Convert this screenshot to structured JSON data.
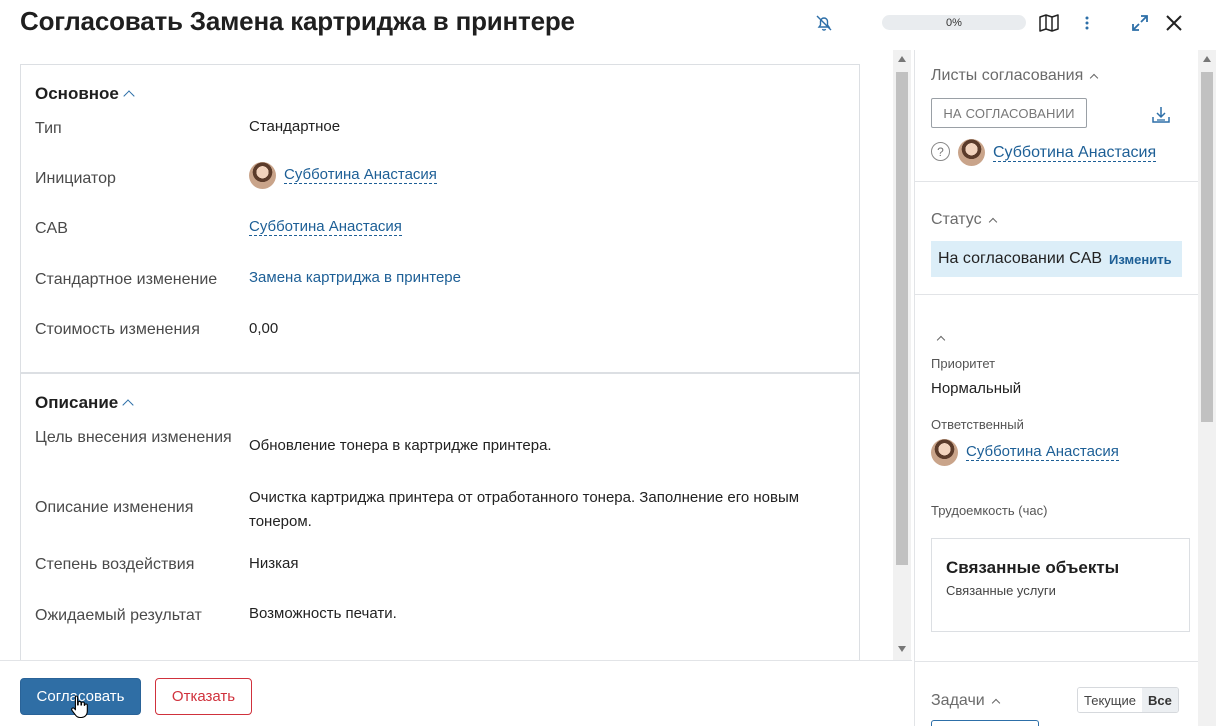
{
  "header": {
    "title": "Согласовать Замена картриджа в принтере",
    "progress": "0%",
    "icons": [
      "bell-off-icon",
      "map-icon",
      "more-vertical-icon",
      "expand-icon",
      "close-icon"
    ]
  },
  "main": {
    "section_main": {
      "title": "Основное",
      "rows": [
        {
          "label": "Тип",
          "value": "Стандартное"
        },
        {
          "label": "Инициатор",
          "value": "Субботина Анастасия"
        },
        {
          "label": "CAB",
          "value": "Субботина Анастасия"
        },
        {
          "label": "Стандартное изменение",
          "value": "Замена картриджа в принтере"
        },
        {
          "label": "Стоимость изменения",
          "value": "0,00"
        }
      ]
    },
    "section_desc": {
      "title": "Описание",
      "rows": [
        {
          "label": "Цель внесения изменения",
          "value": "Обновление тонера в картридже принтера."
        },
        {
          "label": "Описание изменения",
          "value": "Очистка картриджа принтера от отработанного тонера. Заполнение его новым тонером."
        },
        {
          "label": "Степень воздействия",
          "value": "Низкая"
        },
        {
          "label": "Ожидаемый результат",
          "value": "Возможность печати."
        }
      ]
    }
  },
  "footer": {
    "approve_label": "Согласовать",
    "reject_label": "Отказать"
  },
  "sidebar": {
    "approval_sheets": {
      "title": "Листы согласования",
      "tag": "НА СОГЛАСОВАНИИ",
      "person": "Субботина Анастасия"
    },
    "status": {
      "title": "Статус",
      "value": "На согласовании CAB",
      "change_label": "Изменить"
    },
    "priority_label": "Приоритет",
    "priority_value": "Нормальный",
    "responsible_label": "Ответственный",
    "responsible_value": "Субботина Анастасия",
    "labor_label": "Трудоемкость (час)",
    "linked": {
      "title": "Связанные объекты",
      "subtitle": "Связанные услуги"
    },
    "tasks": {
      "title": "Задачи",
      "tab_current": "Текущие",
      "tab_all": "Все"
    }
  },
  "colors": {
    "accent": "#2f6ea5",
    "link": "#1d5f96",
    "danger": "#d0313c",
    "status_bg": "#dceef8"
  }
}
